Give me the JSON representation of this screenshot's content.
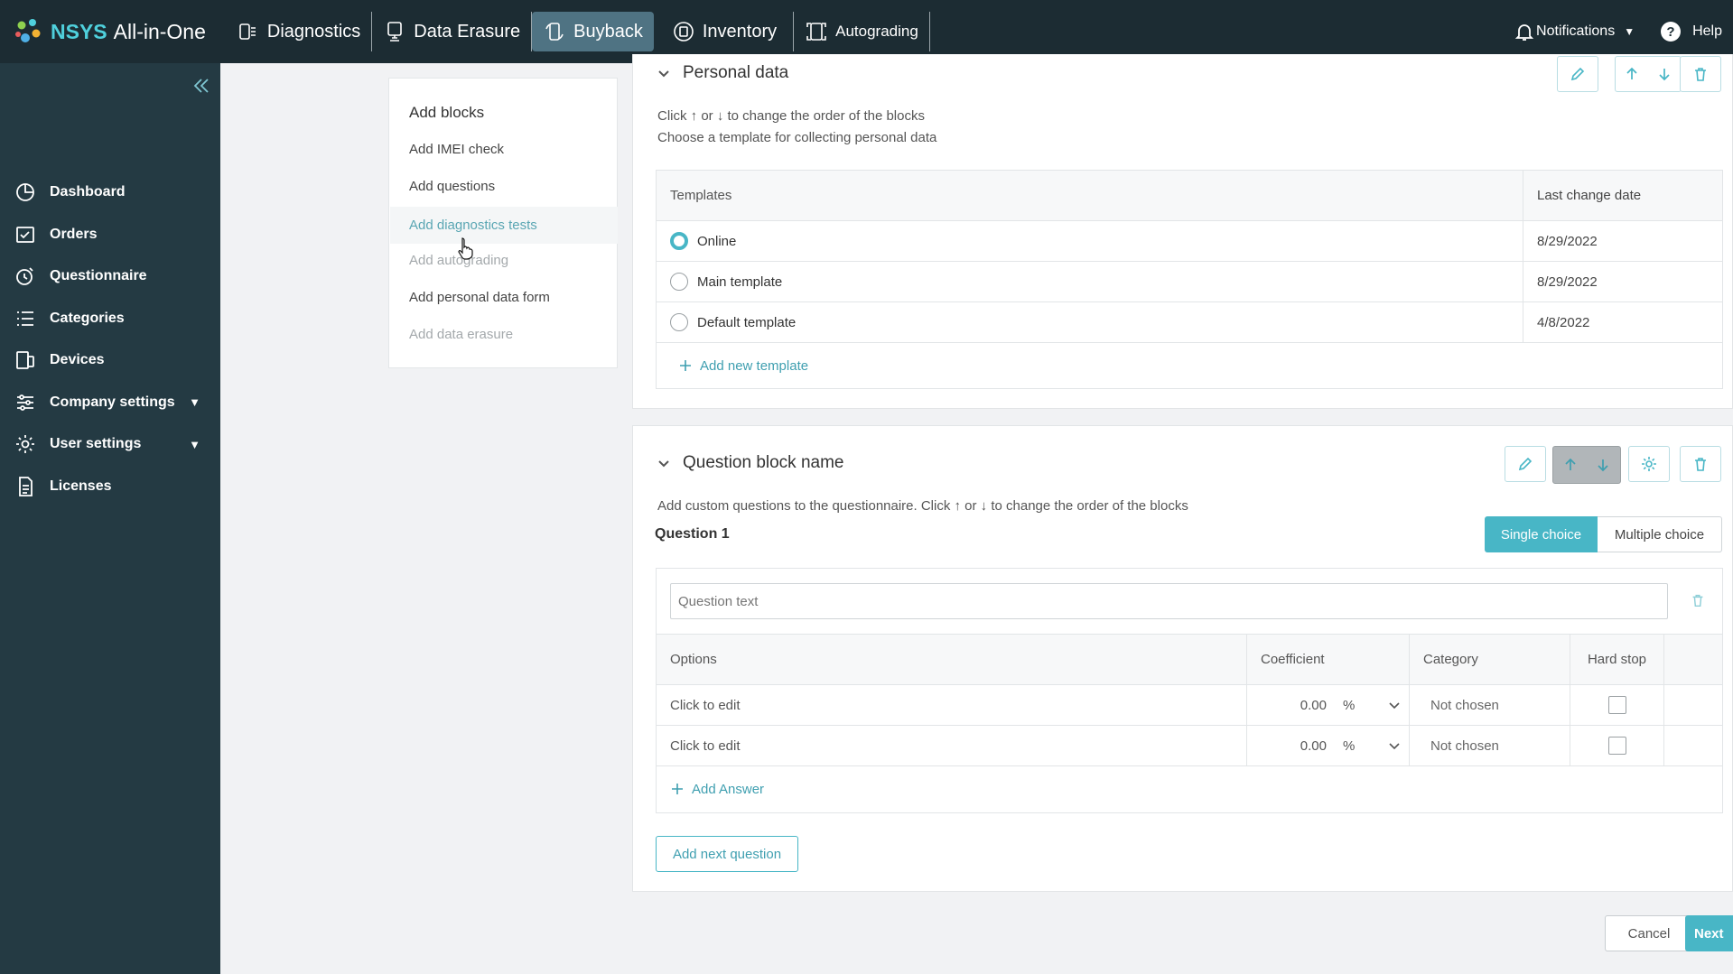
{
  "brand": {
    "part1": "NSYS",
    "part2": "All-in-One"
  },
  "topnav": [
    {
      "label": "Diagnostics",
      "icon": "diagnostics-icon",
      "active": false
    },
    {
      "label": "Data Erasure",
      "icon": "data-erasure-icon",
      "active": false
    },
    {
      "label": "Buyback",
      "icon": "buyback-icon",
      "active": true
    },
    {
      "label": "Inventory",
      "icon": "inventory-icon",
      "active": false
    },
    {
      "label": "Autograding",
      "icon": "autograding-icon",
      "active": false
    }
  ],
  "topright": {
    "notifications": "Notifications",
    "help": "Help"
  },
  "sidebar": {
    "items": [
      {
        "label": "Dashboard",
        "icon": "dashboard-icon"
      },
      {
        "label": "Orders",
        "icon": "orders-icon"
      },
      {
        "label": "Questionnaire",
        "icon": "questionnaire-icon"
      },
      {
        "label": "Categories",
        "icon": "categories-icon"
      },
      {
        "label": "Devices",
        "icon": "devices-icon"
      },
      {
        "label": "Company settings",
        "icon": "company-settings-icon",
        "expandable": true
      },
      {
        "label": "User settings",
        "icon": "user-settings-icon",
        "expandable": true
      },
      {
        "label": "Licenses",
        "icon": "licenses-icon"
      }
    ]
  },
  "add_blocks": {
    "title": "Add blocks",
    "items": [
      {
        "label": "Add IMEI check",
        "state": "normal"
      },
      {
        "label": "Add questions",
        "state": "normal"
      },
      {
        "label": "Add diagnostics tests",
        "state": "hover"
      },
      {
        "label": "Add autograding",
        "state": "disabled"
      },
      {
        "label": "Add personal data form",
        "state": "normal"
      },
      {
        "label": "Add data erasure",
        "state": "disabled"
      }
    ]
  },
  "personal_data": {
    "title": "Personal data",
    "hint1": "Click ↑ or ↓ to change the order of the blocks",
    "hint2": "Choose a template for collecting personal data",
    "col_templates": "Templates",
    "col_date": "Last change date",
    "rows": [
      {
        "name": "Online",
        "date": "8/29/2022",
        "selected": true
      },
      {
        "name": "Main template",
        "date": "8/29/2022",
        "selected": false
      },
      {
        "name": "Default template",
        "date": "4/8/2022",
        "selected": false
      }
    ],
    "add_template": "Add new template"
  },
  "question_block": {
    "title": "Question block name",
    "hint": "Add custom questions to the questionnaire. Click ↑ or ↓ to change the order of the blocks",
    "question_label": "Question 1",
    "single_choice": "Single choice",
    "multiple_choice": "Multiple choice",
    "question_placeholder": "Question text",
    "col_options": "Options",
    "col_coefficient": "Coefficient",
    "col_category": "Category",
    "col_hardstop": "Hard stop",
    "answers": [
      {
        "option": "Click to edit",
        "coef": "0.00",
        "unit": "%",
        "category": "Not chosen"
      },
      {
        "option": "Click to edit",
        "coef": "0.00",
        "unit": "%",
        "category": "Not chosen"
      }
    ],
    "add_answer": "Add Answer",
    "add_next_question": "Add next question"
  },
  "footer": {
    "cancel": "Cancel",
    "next": "Next"
  },
  "colors": {
    "accent": "#48b6c6",
    "topbar": "#1c2c33",
    "sidebar": "#243a43",
    "active_nav": "#4f7383"
  }
}
